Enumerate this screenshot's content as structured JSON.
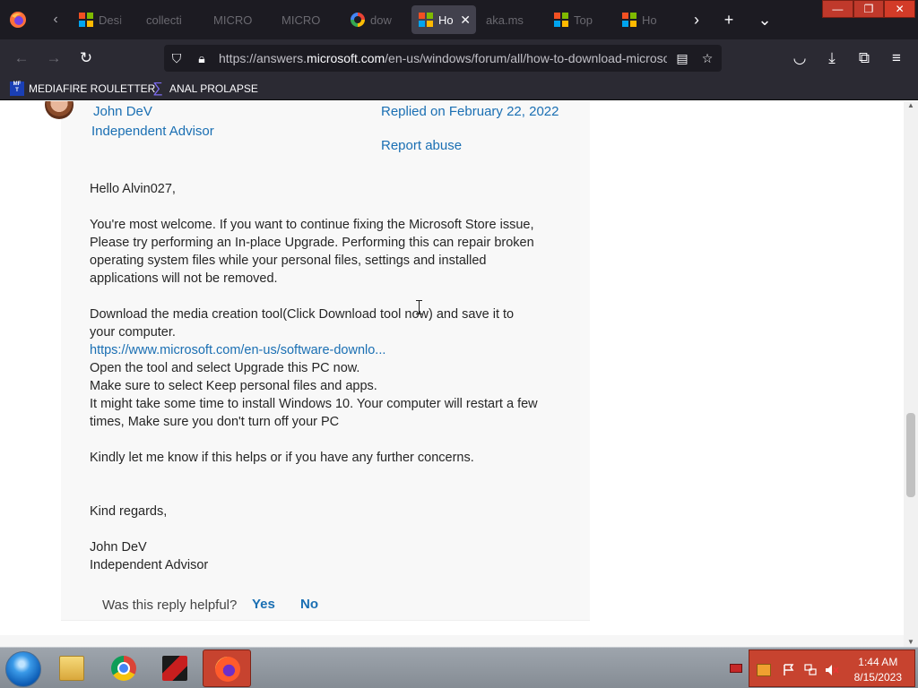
{
  "browser": {
    "tabs": [
      {
        "label": "Desi",
        "favicon": "microsoft-logo",
        "active": false
      },
      {
        "label": "collecti",
        "favicon": "none",
        "active": false
      },
      {
        "label": "MICRO",
        "favicon": "none",
        "active": false
      },
      {
        "label": "MICRO",
        "favicon": "none",
        "active": false
      },
      {
        "label": "dow",
        "favicon": "google-logo",
        "active": false
      },
      {
        "label": "Ho",
        "favicon": "microsoft-logo",
        "active": true
      },
      {
        "label": "aka.ms",
        "favicon": "none",
        "active": false
      },
      {
        "label": "Top",
        "favicon": "microsoft-logo",
        "active": false
      },
      {
        "label": "Ho",
        "favicon": "microsoft-logo",
        "active": false
      }
    ],
    "url": {
      "prefix": "https://answers.",
      "domain": "microsoft.com",
      "suffix": "/en-us/windows/forum/all/how-to-download-microso"
    },
    "bookmarks": [
      {
        "label": "MEDIAFIRE ROULETTER",
        "icon": "mediafire-icon"
      },
      {
        "label": "ANAL PROLAPSE",
        "icon": "sigma-icon"
      }
    ],
    "icons": {
      "back": "←",
      "forward": "→",
      "reload": "↻",
      "tab_scroll_left": "‹",
      "tab_scroll_right": "›",
      "new_tab": "+",
      "list_tabs": "⌄",
      "shield": "⛉",
      "lock": "🔒︎",
      "reader": "▤",
      "star": "☆",
      "pocket": "◡",
      "download": "⤓",
      "extensions": "⧉",
      "menu": "≡",
      "close": "✕",
      "minimize": "—",
      "restore": "❐",
      "window_close": "✕"
    }
  },
  "reply": {
    "author_name": "John DeV",
    "author_role": "Independent Advisor",
    "replied_on": "Replied on February 22, 2022",
    "report_abuse": "Report abuse",
    "greeting": "Hello Alvin027,",
    "para1": [
      "You're most welcome. If you want to continue fixing the Microsoft Store issue,",
      "Please try performing an In-place Upgrade. Performing this can repair broken",
      "operating system files while your personal files, settings and installed",
      "applications will not be removed."
    ],
    "para2": [
      "Download the media creation tool(Click Download tool now) and save it to",
      "your computer."
    ],
    "link": "https://www.microsoft.com/en-us/software-downlo...",
    "steps": [
      "Open the tool and select Upgrade this PC now.",
      "Make sure to select Keep personal files and apps.",
      "It might take some time to install Windows 10. Your computer will restart a few",
      "times, Make sure you don't turn off your PC"
    ],
    "closing": "Kindly let me know if this helps or if you have any further concerns.",
    "regards": "Kind regards,",
    "signature_name": "John DeV",
    "signature_role": "Independent Advisor",
    "helpful_question": "Was this reply helpful?",
    "yes": "Yes",
    "no": "No"
  },
  "taskbar": {
    "apps": [
      "file-explorer-icon",
      "chrome-icon",
      "red-app-icon",
      "firefox-icon"
    ],
    "active_app": "firefox-icon",
    "time": "1:44 AM",
    "date": "8/15/2023"
  },
  "colors": {
    "link_blue": "#1a6fb3",
    "browser_dark": "#1c1b22",
    "taskbar_accent": "#c7432f"
  }
}
